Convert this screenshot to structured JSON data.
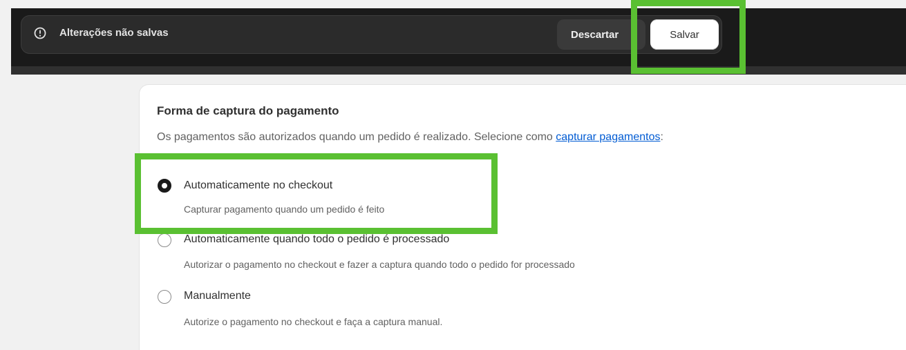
{
  "save_bar": {
    "warning_icon": "exclamation-circle-icon",
    "message": "Alterações não salvas",
    "discard_label": "Descartar",
    "save_label": "Salvar"
  },
  "payment_capture": {
    "title": "Forma de captura do pagamento",
    "description_prefix": "Os pagamentos são autorizados quando um pedido é realizado. Selecione como ",
    "description_link": "capturar pagamentos",
    "description_suffix": ":",
    "options": [
      {
        "label": "Automaticamente no checkout",
        "help": "Capturar pagamento quando um pedido é feito",
        "selected": true
      },
      {
        "label": "Automaticamente quando todo o pedido é processado",
        "help": "Autorizar o pagamento no checkout e fazer a captura quando todo o pedido for processado",
        "selected": false
      },
      {
        "label": "Manualmente",
        "help": "Autorize o pagamento no checkout e faça a captura manual.",
        "selected": false
      }
    ]
  },
  "colors": {
    "highlight": "#5ac032",
    "save_bar_bg": "#1a1a1a",
    "link": "#005bd3"
  }
}
